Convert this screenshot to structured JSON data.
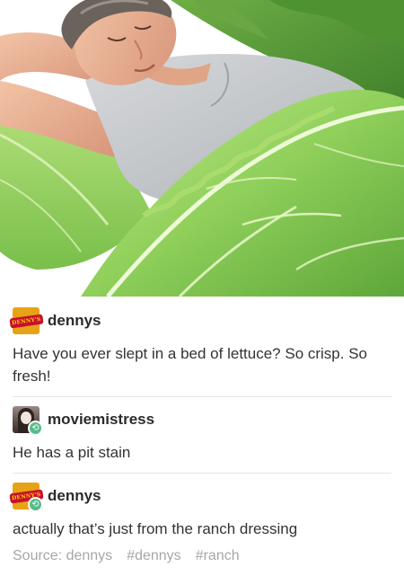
{
  "posts": [
    {
      "username": "dennys",
      "avatar_icon": "dennys-logo-icon",
      "avatar_text": "DENNY'S",
      "text": "Have you ever slept in a bed of lettuce? So crisp. So fresh!"
    },
    {
      "username": "moviemistress",
      "avatar_icon": "user-avatar-icon",
      "reblog_icon": "reblog-icon",
      "text": "He has a pit stain"
    },
    {
      "username": "dennys",
      "avatar_icon": "dennys-logo-icon",
      "avatar_text": "DENNY'S",
      "reblog_icon": "reblog-icon",
      "text": "actually that’s just from the ranch dressing"
    }
  ],
  "footer": {
    "source": "Source: dennys",
    "tags": [
      "#dennys",
      "#ranch"
    ]
  },
  "colors": {
    "reblog_green": "#56bc8a",
    "lettuce": "#8fcf5a",
    "shirt": "#c9ccd0",
    "muted_text": "#a7a7a7"
  }
}
